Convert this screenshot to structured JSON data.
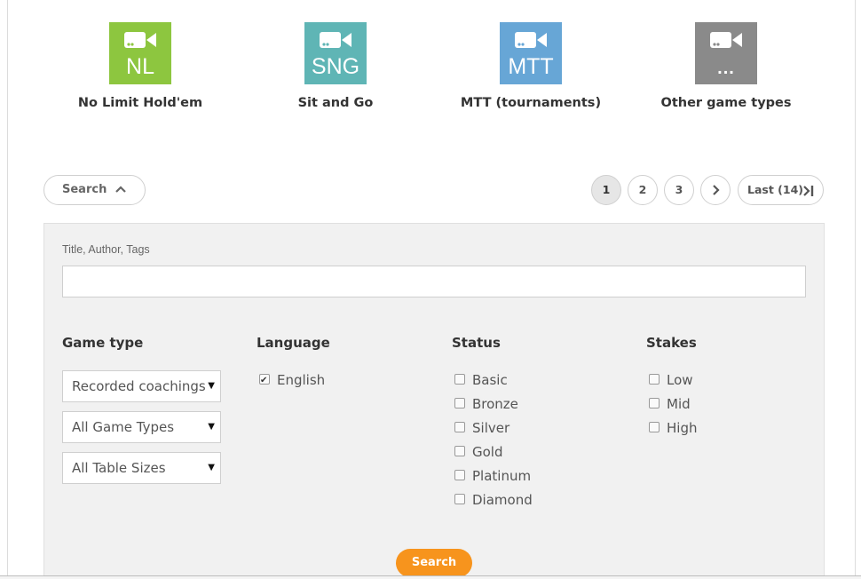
{
  "game_types": [
    {
      "abbr": "NL",
      "label": "No Limit Hold'em",
      "color": "#8dc63f",
      "icon": "video-camera-icon"
    },
    {
      "abbr": "SNG",
      "label": "Sit and Go",
      "color": "#5fb5b5",
      "icon": "video-camera-icon"
    },
    {
      "abbr": "MTT",
      "label": "MTT (tournaments)",
      "color": "#67a6d6",
      "icon": "video-camera-icon"
    },
    {
      "abbr": "...",
      "label": "Other game types",
      "color": "#8a8a8a",
      "icon": "video-camera-icon"
    }
  ],
  "search_toggle": {
    "label": "Search",
    "icon": "chevron-up-icon"
  },
  "pagination": {
    "pages": [
      "1",
      "2",
      "3"
    ],
    "active_page": "1",
    "next_icon": "chevron-right-icon",
    "last_label": "Last (14)",
    "last_icon": "skip-last-icon"
  },
  "filters": {
    "text_field": {
      "label": "Title, Author, Tags",
      "value": "",
      "placeholder": ""
    },
    "game_type": {
      "title": "Game type",
      "selects": [
        "Recorded coachings",
        "All Game Types",
        "All Table Sizes"
      ]
    },
    "language": {
      "title": "Language",
      "options": [
        {
          "label": "English",
          "checked": true
        }
      ]
    },
    "status": {
      "title": "Status",
      "options": [
        {
          "label": "Basic",
          "checked": false
        },
        {
          "label": "Bronze",
          "checked": false
        },
        {
          "label": "Silver",
          "checked": false
        },
        {
          "label": "Gold",
          "checked": false
        },
        {
          "label": "Platinum",
          "checked": false
        },
        {
          "label": "Diamond",
          "checked": false
        }
      ]
    },
    "stakes": {
      "title": "Stakes",
      "options": [
        {
          "label": "Low",
          "checked": false
        },
        {
          "label": "Mid",
          "checked": false
        },
        {
          "label": "High",
          "checked": false
        }
      ]
    }
  },
  "submit_label": "Search",
  "colors": {
    "accent": "#f7941d",
    "panel": "#f1f1f1"
  }
}
